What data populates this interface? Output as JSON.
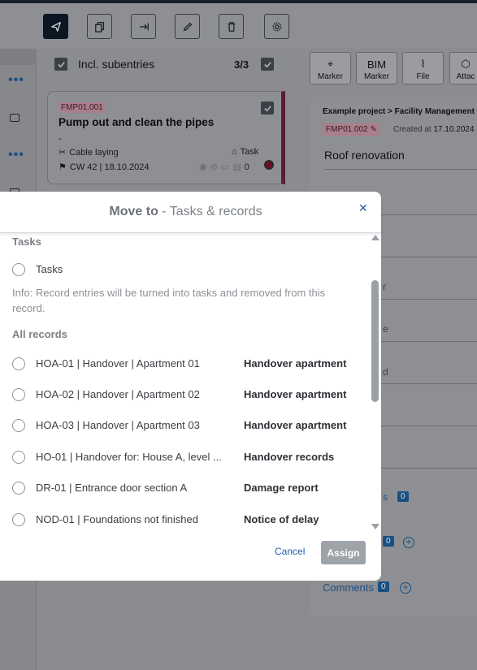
{
  "toolbar": {
    "buttons": [
      {
        "icon": "send-icon",
        "active": true
      },
      {
        "icon": "copy-icon"
      },
      {
        "icon": "move-icon"
      },
      {
        "icon": "edit-icon"
      },
      {
        "icon": "delete-icon"
      },
      {
        "icon": "settings-icon"
      }
    ]
  },
  "middle": {
    "incl_label": "Incl. subentries",
    "count_value": "3/3",
    "card": {
      "tag": "FMP01.001",
      "title": "Pump out and clean the pipes",
      "dash": "-",
      "category": "Cable laying",
      "type": "Task",
      "date": "CW 42 | 18.10.2024",
      "comment_count": "0"
    }
  },
  "right": {
    "buttons": [
      {
        "icon": "marker-icon",
        "label": "Marker"
      },
      {
        "icon": "bim-text",
        "big": "BIM",
        "label": "Marker"
      },
      {
        "icon": "paperclip-icon",
        "label": "File"
      },
      {
        "icon": "cube-icon",
        "label": "Attac"
      }
    ],
    "breadcrumb": "Example project > Facility Management",
    "tag": "FMP01.002",
    "created_prefix": "Created at",
    "created_date": "17.10.2024",
    "title": "Roof renovation",
    "fragments": [
      "r",
      "e",
      "d",
      "s"
    ],
    "badge_counts": [
      "0",
      "0",
      "0"
    ],
    "comments_label": "Comments"
  },
  "modal": {
    "title_bold": "Move to",
    "title_rest": " - Tasks & records",
    "close_icon": "close-icon",
    "section_tasks": "Tasks",
    "option_tasks": "Tasks",
    "info": "Info: Record entries will be turned into tasks and removed from this record.",
    "section_records": "All records",
    "records": [
      {
        "label": "HOA-01 | Handover | Apartment 01",
        "type": "Handover apartment"
      },
      {
        "label": "HOA-02 | Handover | Apartment 02",
        "type": "Handover apartment"
      },
      {
        "label": "HOA-03 | Handover | Apartment 03",
        "type": "Handover apartment"
      },
      {
        "label": "HO-01 | Handover for: House A, level ...",
        "type": "Handover records"
      },
      {
        "label": "DR-01 | Entrance door section A",
        "type": "Damage report"
      },
      {
        "label": "NOD-01 | Foundations not finished",
        "type": "Notice of delay"
      }
    ],
    "cancel_label": "Cancel",
    "assign_label": "Assign"
  }
}
